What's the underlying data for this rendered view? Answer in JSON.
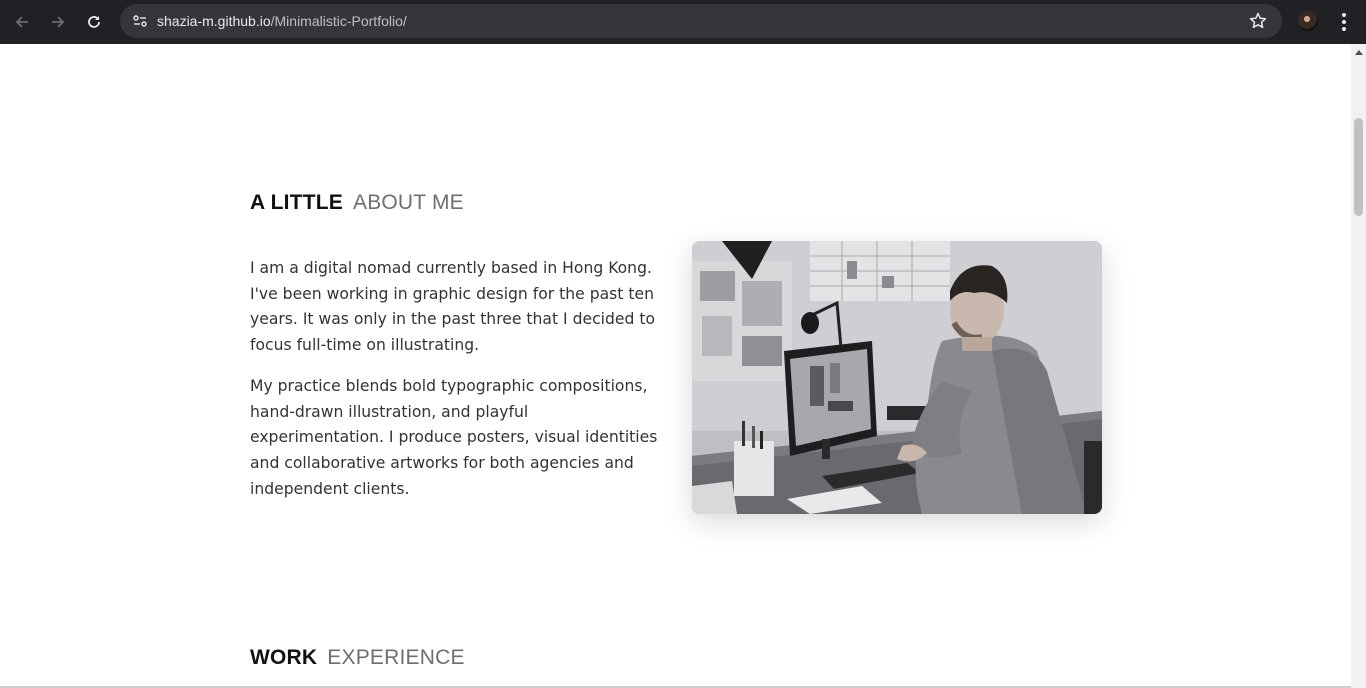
{
  "browser": {
    "url_host": "shazia-m.github.io",
    "url_path": "/Minimalistic-Portfolio/"
  },
  "about": {
    "title_bold": "A LITTLE",
    "title_light": "ABOUT ME",
    "paragraphs": [
      "I am a digital nomad currently based in Hong Kong. I've been working in graphic design for the past ten years. It was only in the past three that I decided to focus full-time on illustrating.",
      "My practice blends bold typographic compositions, hand-drawn illustration, and playful experimentation. I produce posters, visual identities and collaborative artworks for both agencies and independent clients."
    ]
  },
  "work": {
    "title_bold": "WORK",
    "title_light": "EXPERIENCE"
  }
}
